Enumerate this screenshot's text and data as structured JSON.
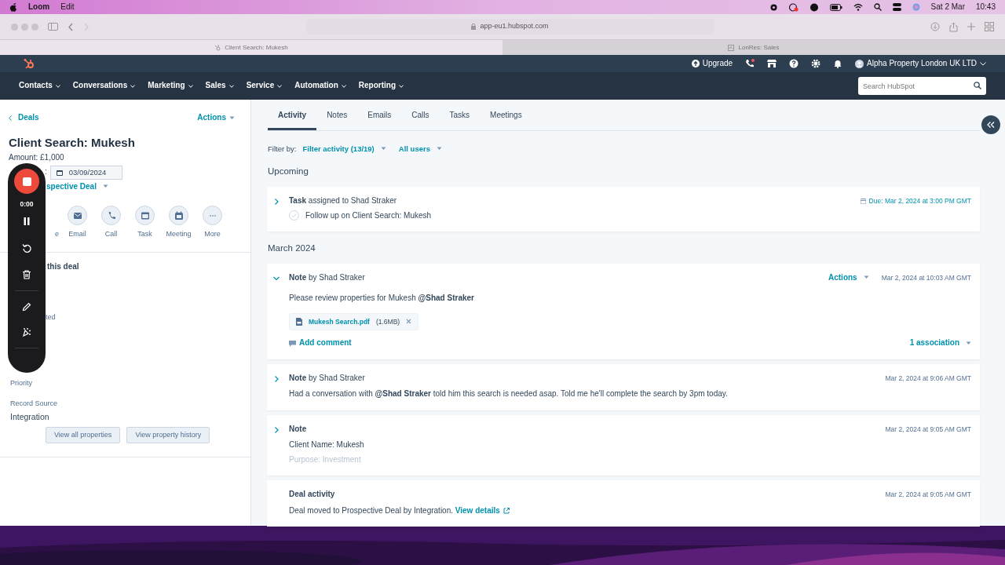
{
  "menubar": {
    "app": "Loom",
    "menus": [
      "Edit"
    ],
    "date": "Sat 2 Mar",
    "time": "10:43"
  },
  "browser": {
    "url": "app-eu1.hubspot.com",
    "tabs": [
      {
        "title": "Client Search: Mukesh",
        "selected": true
      },
      {
        "title": "LonRes: Sales",
        "selected": false
      }
    ]
  },
  "topbar": {
    "upgrade": "Upgrade",
    "account": "Alpha Property London UK LTD"
  },
  "nav": {
    "items": [
      "Contacts",
      "Conversations",
      "Marketing",
      "Sales",
      "Service",
      "Automation",
      "Reporting"
    ],
    "search": {
      "placeholder": "Search HubSpot"
    }
  },
  "record": {
    "back": "Deals",
    "actions": "Actions",
    "title": "Client Search: Mukesh",
    "amount": "Amount: £1,000",
    "close_date_label": ":",
    "close_date": "03/09/2024",
    "stage": "spective Deal",
    "quick_actions": [
      {
        "label": "e",
        "kind": "hidden"
      },
      {
        "label": "Email",
        "kind": "email"
      },
      {
        "label": "Call",
        "kind": "call"
      },
      {
        "label": "Task",
        "kind": "task"
      },
      {
        "label": "Meeting",
        "kind": "meeting"
      },
      {
        "label": "More",
        "kind": "more"
      }
    ],
    "section_title": "this deal",
    "field_fragment": "ted",
    "properties": [
      {
        "label": "Priority"
      },
      {
        "label": "Record Source",
        "value": "Integration"
      }
    ],
    "buttons": [
      "View all properties",
      "View property history"
    ]
  },
  "recorder": {
    "time": "0:00"
  },
  "timeline": {
    "tabs": [
      {
        "label": "Activity",
        "selected": true
      },
      {
        "label": "Notes",
        "selected": false
      },
      {
        "label": "Emails",
        "selected": false
      },
      {
        "label": "Calls",
        "selected": false
      },
      {
        "label": "Tasks",
        "selected": false
      },
      {
        "label": "Meetings",
        "selected": false
      }
    ],
    "filter_label": "Filter by:",
    "filters": [
      "Filter activity (13/19)",
      "All users"
    ],
    "groups": [
      {
        "title": "Upcoming",
        "items": [
          {
            "kind": "task",
            "expanded": false,
            "type": "Task",
            "byline": "assigned to Shad Straker",
            "date": "Due: Mar 2, 2024 at 3:00 PM GMT",
            "task_title": "Follow up on Client Search: Mukesh",
            "completed": false
          }
        ]
      },
      {
        "title": "March 2024",
        "items": [
          {
            "kind": "note",
            "expanded": true,
            "type": "Note",
            "byline": "by Shad Straker",
            "actions": "Actions",
            "date": "Mar 2, 2024 at 10:03 AM GMT",
            "lines": [
              {
                "text": "Please review properties for Mukesh **@Shad Straker**",
                "faded": false
              }
            ],
            "attachment": {
              "name": "Mukesh Search.pdf",
              "size": "(1.6MB)"
            },
            "comment": "Add comment",
            "associations": "1 association"
          },
          {
            "kind": "note",
            "expanded": false,
            "type": "Note",
            "byline": "by Shad Straker",
            "date": "Mar 2, 2024 at 9:06 AM GMT",
            "lines": [
              {
                "text": "Had a conversation with **@Shad Straker** told him this search is needed asap. Told me he'll complete the search by 3pm today.",
                "faded": false
              }
            ]
          },
          {
            "kind": "note",
            "expanded": false,
            "type": "Note",
            "date": "Mar 2, 2024 at 9:05 AM GMT",
            "lines": [
              {
                "text": "Client Name: Mukesh",
                "faded": false
              },
              {
                "text": "Purpose: Investment",
                "faded": true
              }
            ]
          },
          {
            "kind": "activity",
            "type": "Deal activity",
            "date": "Mar 2, 2024 at 9:05 AM GMT",
            "text": "Deal moved to Prospective Deal by Integration.",
            "link": "View details"
          }
        ]
      }
    ]
  }
}
